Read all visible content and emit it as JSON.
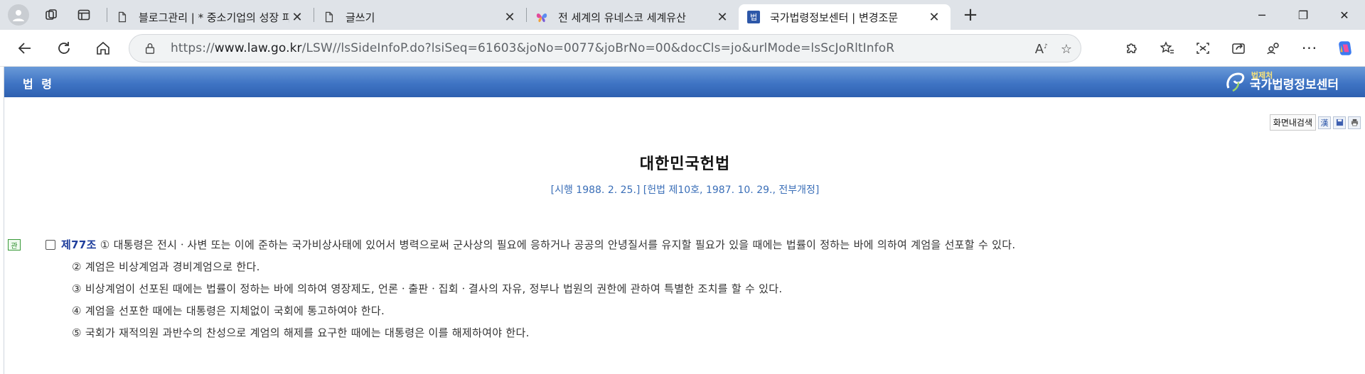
{
  "browser": {
    "tabs": [
      {
        "title": "블로그관리 | * 중소기업의 성장 파",
        "icon": "document-icon",
        "active": false
      },
      {
        "title": "글쓰기",
        "icon": "document-icon",
        "active": false
      },
      {
        "title": "전 세계의 유네스코 세계유산",
        "icon": "butterfly-icon",
        "active": false
      },
      {
        "title": "국가법령정보센터 | 변경조문",
        "icon": "law-favicon",
        "favicon_text": "법",
        "active": true
      }
    ],
    "address": {
      "scheme": "https://",
      "host": "www.law.go.kr",
      "path": "/LSW//lsSideInfoP.do?lsiSeq=61603&joNo=0077&joBrNo=00&docCls=jo&urlMode=lsScJoRltInfoR"
    }
  },
  "page": {
    "bar_label": "법 령",
    "logo": {
      "small": "법제처",
      "big": "국가법령정보센터"
    },
    "tools": {
      "search_label": "화면내검색",
      "hanja_label": "漢"
    },
    "law_title": "대한민국헌법",
    "law_subtitle": "[시행 1988. 2. 25.] [헌법 제10호, 1987. 10. 29., 전부개정]",
    "article": {
      "badge": "관",
      "number": "제77조",
      "paragraphs": [
        "① 대통령은 전시ㆍ사변 또는 이에 준하는 국가비상사태에 있어서 병력으로써 군사상의 필요에 응하거나 공공의 안녕질서를 유지할 필요가 있을 때에는 법률이 정하는 바에 의하여 계엄을 선포할 수 있다.",
        "② 계엄은 비상계엄과 경비계엄으로 한다.",
        "③ 비상계엄이 선포된 때에는 법률이 정하는 바에 의하여 영장제도, 언론ㆍ출판ㆍ집회ㆍ결사의 자유, 정부나 법원의 권한에 관하여 특별한 조치를 할 수 있다.",
        "④ 계엄을 선포한 때에는 대통령은 지체없이 국회에 통고하여야 한다.",
        "⑤ 국회가 재적의원 과반수의 찬성으로 계엄의 해제를 요구한 때에는 대통령은 이를 해제하여야 한다."
      ]
    }
  },
  "colors": {
    "lawbar": "#3f74c4",
    "article_number": "#1f3e9c",
    "subtitle": "#3b6fb8"
  }
}
